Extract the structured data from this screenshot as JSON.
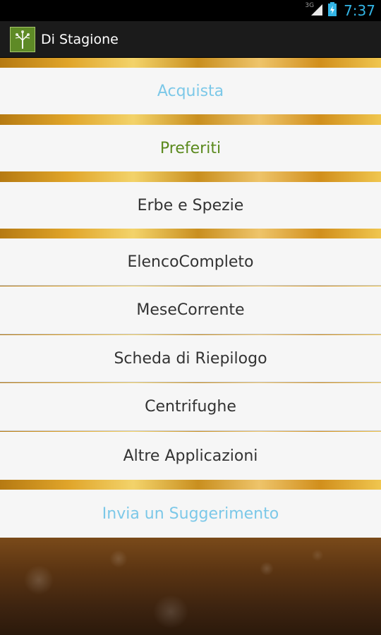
{
  "status_bar": {
    "network": "3G",
    "time": "7:37"
  },
  "action_bar": {
    "icon": "tree-icon",
    "title": "Di Stagione"
  },
  "menu": {
    "acquista": "Acquista",
    "preferiti": "Preferiti",
    "erbe": "Erbe e Spezie",
    "elenco": "ElencoCompleto",
    "mese": "MeseCorrente",
    "scheda": "Scheda di Riepilogo",
    "centrifughe": "Centrifughe",
    "altre": "Altre Applicazioni",
    "invia": "Invia un Suggerimento"
  },
  "colors": {
    "accent_blue": "#7cc8e8",
    "accent_green": "#5b8a1e",
    "clock": "#33b5e5"
  }
}
